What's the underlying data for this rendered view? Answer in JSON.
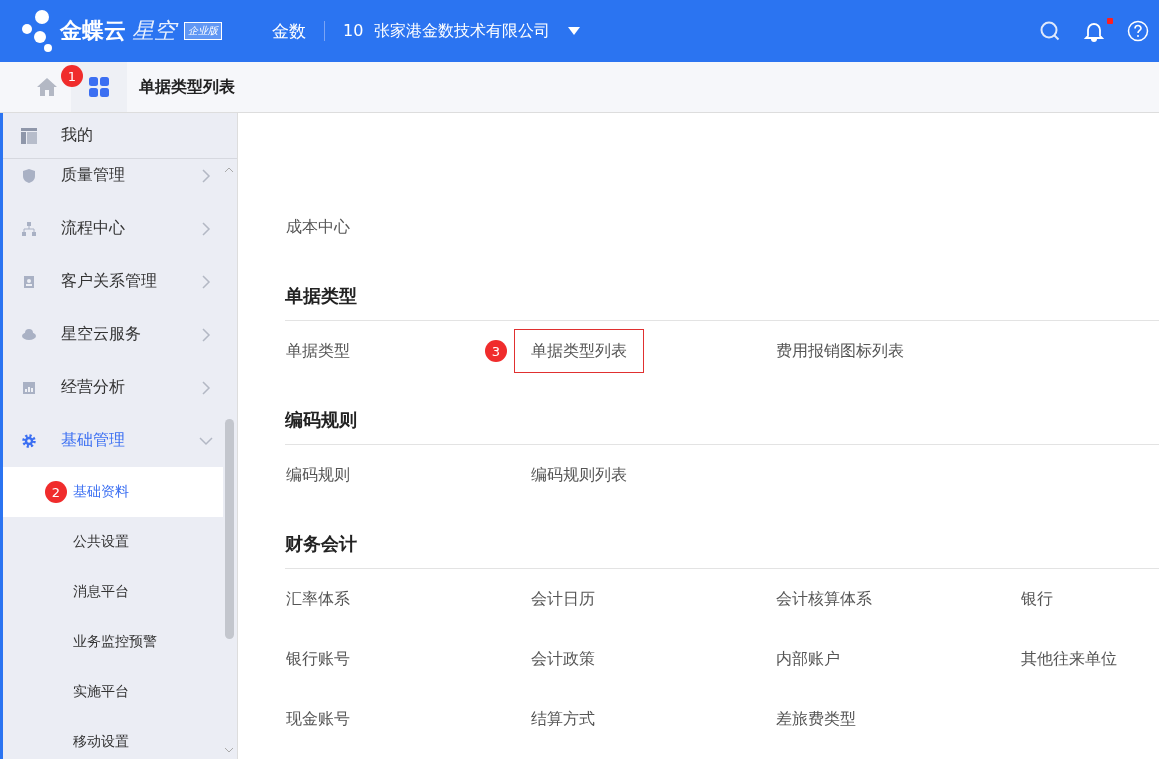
{
  "header": {
    "logo_text": "金蝶云",
    "product": "星空",
    "edition": "企业版",
    "user": "金数",
    "org_code": "10",
    "org_name": "张家港金数技术有限公司",
    "notification_dot": true
  },
  "tabs": [
    {
      "label": "单据类型列表",
      "selected": true
    }
  ],
  "apps_marker": "1",
  "sidebar": {
    "pinned": "我的",
    "items": [
      {
        "label": "质量管理",
        "expanded": false
      },
      {
        "label": "流程中心",
        "expanded": false
      },
      {
        "label": "客户关系管理",
        "expanded": false
      },
      {
        "label": "星空云服务",
        "expanded": false
      },
      {
        "label": "经营分析",
        "expanded": false
      },
      {
        "label": "基础管理",
        "expanded": true,
        "children": [
          {
            "label": "基础资料",
            "selected": true,
            "marker": "2"
          },
          {
            "label": "公共设置",
            "selected": false
          },
          {
            "label": "消息平台",
            "selected": false
          },
          {
            "label": "业务监控预警",
            "selected": false
          },
          {
            "label": "实施平台",
            "selected": false
          },
          {
            "label": "移动设置",
            "selected": false
          }
        ]
      }
    ]
  },
  "sections": [
    {
      "links": [
        {
          "label": "成本中心",
          "highlighted": false
        }
      ]
    },
    {
      "title": "单据类型",
      "links": [
        {
          "label": "单据类型",
          "highlighted": false
        },
        {
          "label": "单据类型列表",
          "highlighted": true,
          "marker": "3"
        },
        {
          "label": "费用报销图标列表",
          "highlighted": false
        }
      ]
    },
    {
      "title": "编码规则",
      "links": [
        {
          "label": "编码规则",
          "highlighted": false
        },
        {
          "label": "编码规则列表",
          "highlighted": false
        }
      ]
    },
    {
      "title": "财务会计",
      "links": [
        {
          "label": "汇率体系",
          "highlighted": false
        },
        {
          "label": "会计日历",
          "highlighted": false
        },
        {
          "label": "会计核算体系",
          "highlighted": false
        },
        {
          "label": "银行",
          "highlighted": false
        },
        {
          "label": "银行账号",
          "highlighted": false
        },
        {
          "label": "会计政策",
          "highlighted": false
        },
        {
          "label": "内部账户",
          "highlighted": false
        },
        {
          "label": "其他往来单位",
          "highlighted": false
        },
        {
          "label": "现金账号",
          "highlighted": false
        },
        {
          "label": "结算方式",
          "highlighted": false
        },
        {
          "label": "差旅费类型",
          "highlighted": false
        }
      ]
    }
  ]
}
